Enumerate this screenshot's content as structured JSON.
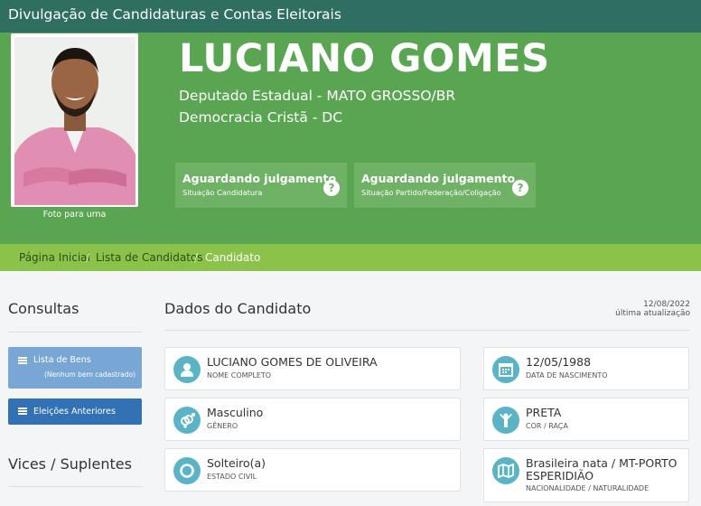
{
  "header": {
    "title": "Divulgação de Candidaturas e Contas Eleitorais"
  },
  "candidate": {
    "name": "LUCIANO GOMES",
    "office": "Deputado Estadual - MATO GROSSO/BR",
    "party": "Democracia Cristã - DC",
    "photo_caption": "Foto para urna"
  },
  "status": [
    {
      "title": "Aguardando julgamento",
      "subtitle": "Situação Candidatura"
    },
    {
      "title": "Aguardando julgamento",
      "subtitle": "Situação Partido/Federação/Coligação"
    }
  ],
  "breadcrumb": [
    "Página Inicial",
    "Lista de Candidatos",
    "Candidato"
  ],
  "sidebar": {
    "consultas_title": "Consultas",
    "lista_bens": "Lista de Bens",
    "lista_bens_sub": "(Nenhum bem cadastrado)",
    "eleicoes_anteriores": "Eleições Anteriores",
    "vices_title": "Vices / Suplentes"
  },
  "main": {
    "title": "Dados do Candidato",
    "update_date": "12/08/2022",
    "update_label": "última atualização"
  },
  "details": {
    "nome": {
      "value": "LUCIANO GOMES DE OLIVEIRA",
      "label": "Nome completo"
    },
    "nascimento": {
      "value": "12/05/1988",
      "label": "Data de nascimento"
    },
    "genero": {
      "value": "Masculino",
      "label": "Gênero"
    },
    "cor": {
      "value": "PRETA",
      "label": "Cor / Raça"
    },
    "estado_civil": {
      "value": "Solteiro(a)",
      "label": "Estado civil"
    },
    "nacionalidade": {
      "value": "Brasileira nata / MT-PORTO ESPERIDIÃO",
      "label": "Nacionalidade / Naturalidade"
    }
  },
  "colors": {
    "topbar": "#2e6f62",
    "hero": "#5aa552",
    "breadcrumb_bar": "#8bc34a",
    "info_icon": "#5bb4c6",
    "button_light": "#78a7d6",
    "button_dark": "#3271b4"
  }
}
